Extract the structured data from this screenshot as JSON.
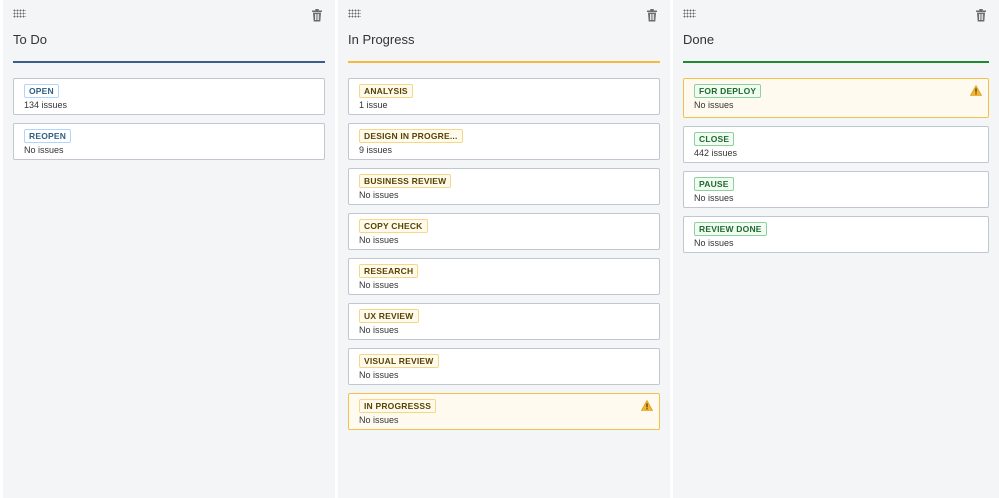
{
  "columns": [
    {
      "title": "To Do",
      "rule_color": "#3b5d8a",
      "statuses": [
        {
          "label": "OPEN",
          "issues": "134 issues",
          "tone": "blue",
          "warning": false
        },
        {
          "label": "REOPEN",
          "issues": "No issues",
          "tone": "blue",
          "warning": false
        }
      ]
    },
    {
      "title": "In Progress",
      "rule_color": "#f5b940",
      "statuses": [
        {
          "label": "ANALYSIS",
          "issues": "1 issue",
          "tone": "yellow",
          "warning": false
        },
        {
          "label": "DESIGN IN PROGRE...",
          "issues": "9 issues",
          "tone": "yellow",
          "warning": false
        },
        {
          "label": "BUSINESS REVIEW",
          "issues": "No issues",
          "tone": "yellow",
          "warning": false
        },
        {
          "label": "COPY CHECK",
          "issues": "No issues",
          "tone": "yellow",
          "warning": false
        },
        {
          "label": "RESEARCH",
          "issues": "No issues",
          "tone": "yellow",
          "warning": false
        },
        {
          "label": "UX REVIEW",
          "issues": "No issues",
          "tone": "yellow",
          "warning": false
        },
        {
          "label": "VISUAL REVIEW",
          "issues": "No issues",
          "tone": "yellow",
          "warning": false
        },
        {
          "label": "IN PROGRESSS",
          "issues": "No issues",
          "tone": "yellow",
          "warning": true
        }
      ]
    },
    {
      "title": "Done",
      "rule_color": "#1e8b34",
      "statuses": [
        {
          "label": "FOR DEPLOY",
          "issues": "No issues",
          "tone": "green",
          "warning": true
        },
        {
          "label": "CLOSE",
          "issues": "442 issues",
          "tone": "green",
          "warning": false
        },
        {
          "label": "PAUSE",
          "issues": "No issues",
          "tone": "green",
          "warning": false
        },
        {
          "label": "REVIEW DONE",
          "issues": "No issues",
          "tone": "green",
          "warning": false
        }
      ]
    }
  ],
  "icons": {
    "drag": "drag-handle-icon",
    "delete": "trash-icon",
    "warning": "warning-icon"
  }
}
